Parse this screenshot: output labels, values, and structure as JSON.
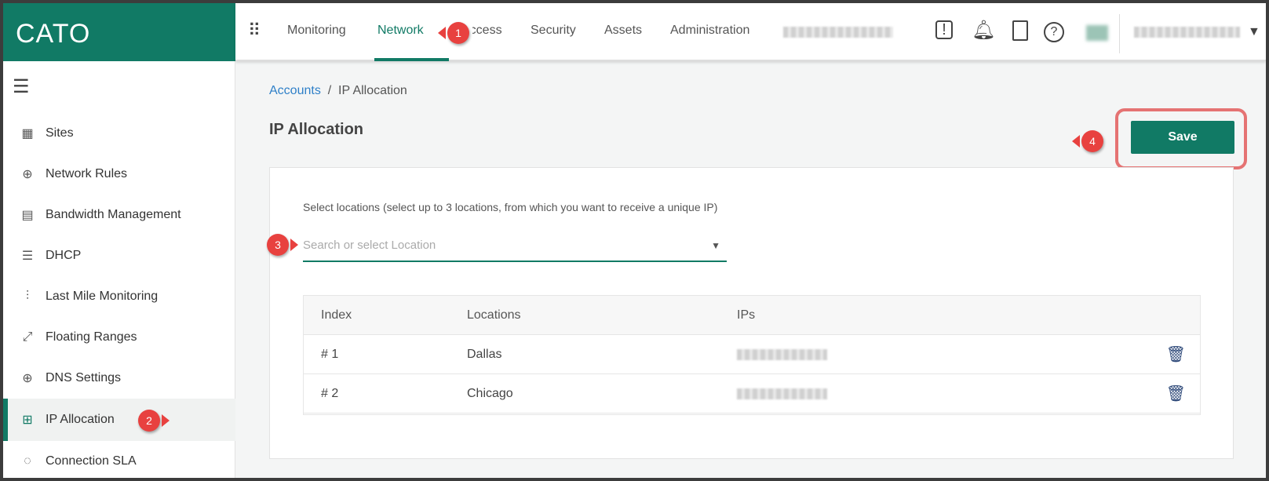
{
  "brand": {
    "logo": "CATO",
    "accent": "#117a65"
  },
  "topnav": {
    "items": [
      "Monitoring",
      "Network",
      "Access",
      "Security",
      "Assets",
      "Administration"
    ],
    "active": "Network"
  },
  "header_icons": [
    "apps-grid-icon",
    "feedback-icon",
    "bell-icon",
    "video-guide-icon",
    "help-icon",
    "avatar",
    "chevron-down-icon"
  ],
  "sidebar": {
    "items": [
      {
        "label": "Sites",
        "icon": "building-icon"
      },
      {
        "label": "Network Rules",
        "icon": "globe-icon"
      },
      {
        "label": "Bandwidth Management",
        "icon": "bandwidth-icon"
      },
      {
        "label": "DHCP",
        "icon": "document-icon"
      },
      {
        "label": "Last Mile Monitoring",
        "icon": "waveform-icon"
      },
      {
        "label": "Floating Ranges",
        "icon": "expand-icon"
      },
      {
        "label": "DNS Settings",
        "icon": "globe-icon"
      },
      {
        "label": "IP Allocation",
        "icon": "layout-icon",
        "active": true
      },
      {
        "label": "Connection SLA",
        "icon": "sla-icon"
      }
    ]
  },
  "breadcrumb": {
    "root": "Accounts",
    "sep": "/",
    "current": "IP Allocation"
  },
  "page": {
    "title": "IP Allocation",
    "save_label": "Save",
    "instruction": "Select locations (select up to 3 locations, from which you want to receive a unique IP)",
    "search_placeholder": "Search or select Location"
  },
  "table": {
    "headers": [
      "Index",
      "Locations",
      "IPs"
    ],
    "rows": [
      {
        "index": "# 1",
        "location": "Dallas"
      },
      {
        "index": "# 2",
        "location": "Chicago"
      }
    ]
  },
  "callouts": [
    "1",
    "2",
    "3",
    "4"
  ]
}
